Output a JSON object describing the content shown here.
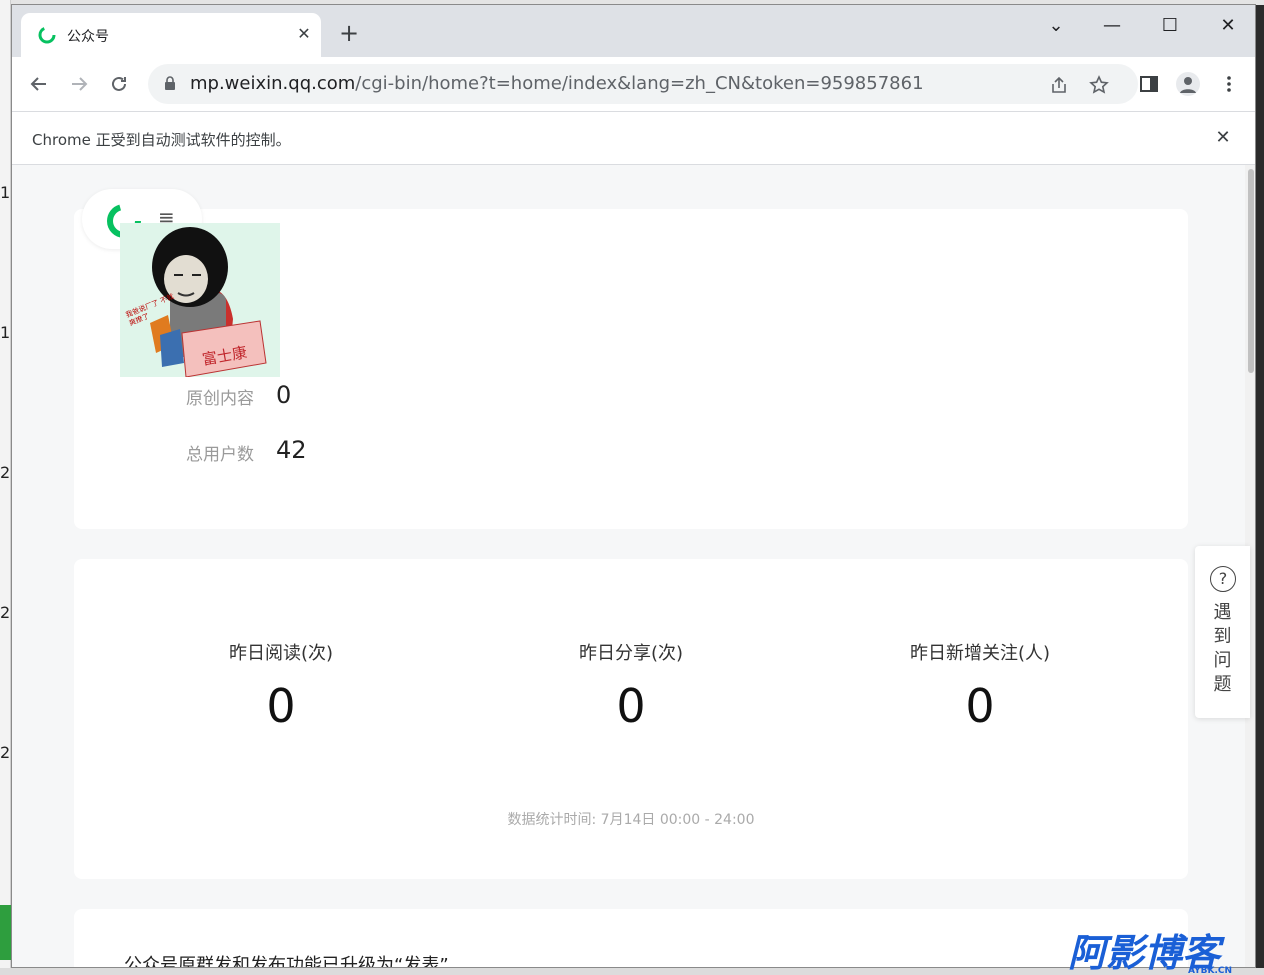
{
  "browser": {
    "tab_title": "公众号",
    "tab_close": "✕",
    "new_tab": "+",
    "url_host": "mp.weixin.qq.com",
    "url_path": "/cgi-bin/home?t=home/index&lang=zh_CN&token=959857861",
    "infobar_message": "Chrome 正受到自动测试软件的控制。",
    "infobar_close": "✕",
    "window_controls": {
      "tabsearch": "⌄",
      "minimize": "—",
      "maximize": "☐",
      "close": "✕"
    }
  },
  "account": {
    "menu_icon": "≡",
    "avatar_caption": "富士康",
    "avatar_side_text": "我爸说厂了 不就爽撩了",
    "stats": [
      {
        "label": "原创内容",
        "value": "0"
      },
      {
        "label": "总用户数",
        "value": "42"
      }
    ]
  },
  "daily": {
    "items": [
      {
        "label": "昨日阅读(次)",
        "value": "0"
      },
      {
        "label": "昨日分享(次)",
        "value": "0"
      },
      {
        "label": "昨日新增关注(人)",
        "value": "0"
      }
    ],
    "time_note": "数据统计时间: 7月14日 00:00 - 24:00"
  },
  "notice": {
    "text": "公众号原群发和发布功能已升级为“发表”"
  },
  "help": {
    "icon_text": "?",
    "label": "遇到问题"
  },
  "watermark": {
    "text": "阿影博客",
    "sub": "AYBK.CN"
  },
  "desktop": {
    "left_marks": [
      "1",
      "1",
      "2",
      "2",
      "2"
    ]
  },
  "colors": {
    "wechat_green": "#07c160",
    "page_bg": "#f6f7f8",
    "card_bg": "#ffffff",
    "watermark_blue": "#1a5fd6"
  },
  "icons": [
    "wechat-logo-icon",
    "lock-icon",
    "back-arrow-icon",
    "forward-arrow-icon",
    "reload-icon",
    "share-icon",
    "star-icon",
    "side-panel-icon",
    "profile-icon",
    "kebab-menu-icon",
    "help-icon"
  ]
}
